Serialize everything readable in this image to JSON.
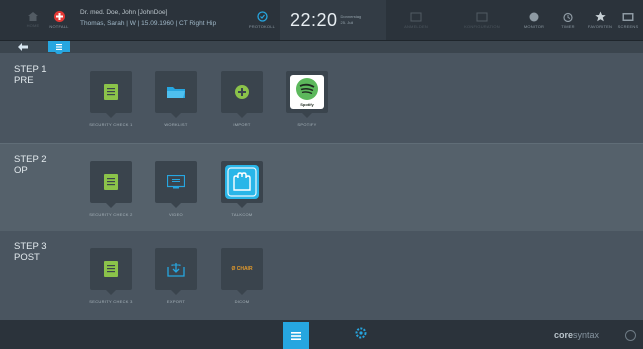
{
  "topbar": {
    "home_label": "HOME",
    "notfall_label": "NOTFALL",
    "user_line": "Dr. med. Doe, John [JohnDoe]",
    "patient_line": "Thomas, Sarah | W | 15.09.1960 | CT Right Hip",
    "time_label": "PROTOKOLL",
    "clock": "22:20",
    "date_day": "Donnerstag",
    "date": "25. Juli",
    "action_1": "ANMELDEN",
    "action_2": "KONFIGURATION",
    "monitor_label": "MONITOR",
    "timer_label": "TIMER",
    "favorites_label": "FAVORITEN",
    "screens_label": "SCREENS"
  },
  "sections": [
    {
      "title_line1": "STEP 1",
      "title_line2": "PRE",
      "apps": [
        {
          "label": "SECURITY CHECK 1"
        },
        {
          "label": "WORKLIST"
        },
        {
          "label": "IMPORT"
        },
        {
          "label": "SPOTIFY",
          "logo_text": "Spotify"
        }
      ]
    },
    {
      "title_line1": "STEP 2",
      "title_line2": "OP",
      "apps": [
        {
          "label": "SECURITY CHECK 2"
        },
        {
          "label": "VIDEO"
        },
        {
          "label": "TALKCOM"
        }
      ]
    },
    {
      "title_line1": "STEP 3",
      "title_line2": "POST",
      "apps": [
        {
          "label": "SECURITY CHECK 3"
        },
        {
          "label": "EXPORT"
        },
        {
          "label": "DICOM",
          "logo_text": "Ø CHAIR"
        }
      ]
    }
  ],
  "bottombar": {
    "brand_prefix": "core",
    "brand_suffix": "syntax"
  },
  "colors": {
    "accent": "#26a6e0",
    "green_tile": "#8bc34a",
    "bar": "#2b333b"
  }
}
